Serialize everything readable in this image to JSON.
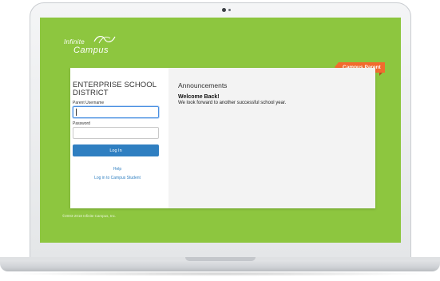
{
  "app": {
    "brand_line1": "Infinite",
    "brand_line2": "Campus",
    "badge": "Campus Parent"
  },
  "login": {
    "district_name": "ENTERPRISE SCHOOL DISTRICT",
    "username_label": "Parent Username",
    "username_value": "",
    "password_label": "Password",
    "password_value": "",
    "login_button": "Log In",
    "help_link": "Help",
    "student_link": "Log in to Campus Student"
  },
  "announcements": {
    "title": "Announcements",
    "heading": "Welcome Back!",
    "body": "We look forward to another successful school year."
  },
  "footer": {
    "copyright": "©2003-2018 Infinite Campus, Inc."
  },
  "colors": {
    "background_green": "#8dc63f",
    "accent_orange": "#f26b2e",
    "button_blue": "#2f7fc1"
  }
}
